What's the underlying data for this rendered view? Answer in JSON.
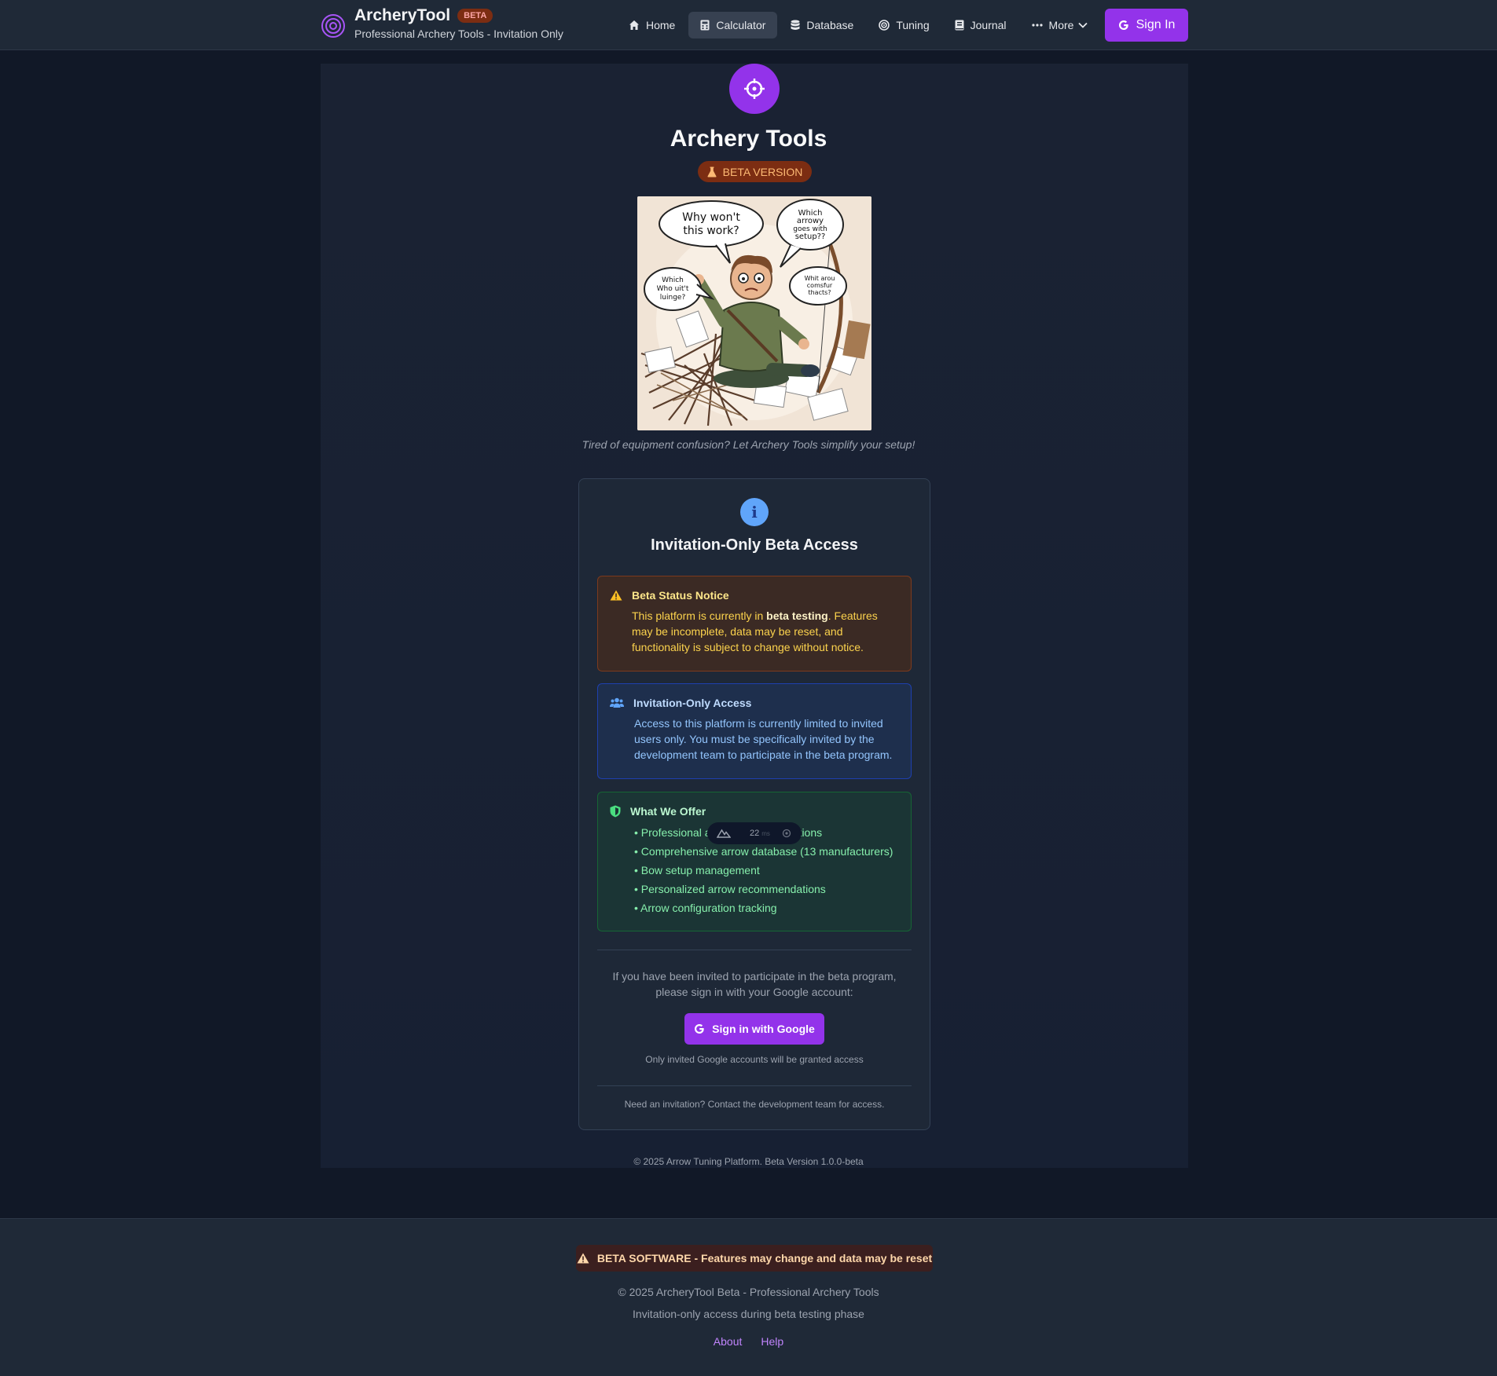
{
  "header": {
    "brand_name": "ArcheryTool",
    "beta_badge": "BETA",
    "brand_subtitle": "Professional Archery Tools - Invitation Only",
    "nav": [
      {
        "label": "Home",
        "icon": "home-icon"
      },
      {
        "label": "Calculator",
        "icon": "calculator-icon",
        "active": true
      },
      {
        "label": "Database",
        "icon": "database-icon"
      },
      {
        "label": "Tuning",
        "icon": "target-icon"
      },
      {
        "label": "Journal",
        "icon": "book-icon"
      },
      {
        "label": "More",
        "icon": "ellipsis-icon"
      }
    ],
    "sign_in": "Sign In"
  },
  "hero": {
    "title": "Archery Tools",
    "badge": "BETA VERSION",
    "image": {
      "bubble_1": "Why won't this work?",
      "bubble_2": "Which arrowy goes with setup??",
      "bubble_3": "Which Who uit't luinge?",
      "bubble_4": "Whit arou comsfur thacts?"
    },
    "caption": "Tired of equipment confusion? Let Archery Tools simplify your setup!"
  },
  "card": {
    "title": "Invitation-Only Beta Access",
    "beta_notice": {
      "title": "Beta Status Notice",
      "text_before": "This platform is currently in ",
      "text_bold": "beta testing",
      "text_after": ". Features may be incomplete, data may be reset, and functionality is subject to change without notice."
    },
    "invite_notice": {
      "title": "Invitation-Only Access",
      "text": "Access to this platform is currently limited to invited users only. You must be specifically invited by the development team to participate in the beta program."
    },
    "offer": {
      "title": "What We Offer",
      "items": [
        "• Professional arrow spine calculations",
        "• Comprehensive arrow database (13 manufacturers)",
        "• Bow setup management",
        "• Personalized arrow recommendations",
        "• Arrow configuration tracking"
      ]
    },
    "perf_overlay": {
      "value": "22",
      "unit": "ms"
    },
    "invite_text": "If you have been invited to participate in the beta program, please sign in with your Google account:",
    "google_button": "Sign in with Google",
    "google_note": "Only invited Google accounts will be granted access",
    "need_invitation": "Need an invitation? Contact the development team for access."
  },
  "panel_copyright": "© 2025 Arrow Tuning Platform. Beta Version 1.0.0-beta",
  "footer": {
    "warning": "BETA SOFTWARE - Features may change and data may be reset",
    "copyright": "© 2025 ArcheryTool Beta - Professional Archery Tools",
    "subtitle": "Invitation-only access during beta testing phase",
    "links": [
      "About",
      "Help"
    ]
  },
  "colors": {
    "accent": "#9333ea",
    "background": "#111827",
    "warning": "#fcd34d",
    "info": "#93c5fd",
    "success": "#86efac"
  }
}
